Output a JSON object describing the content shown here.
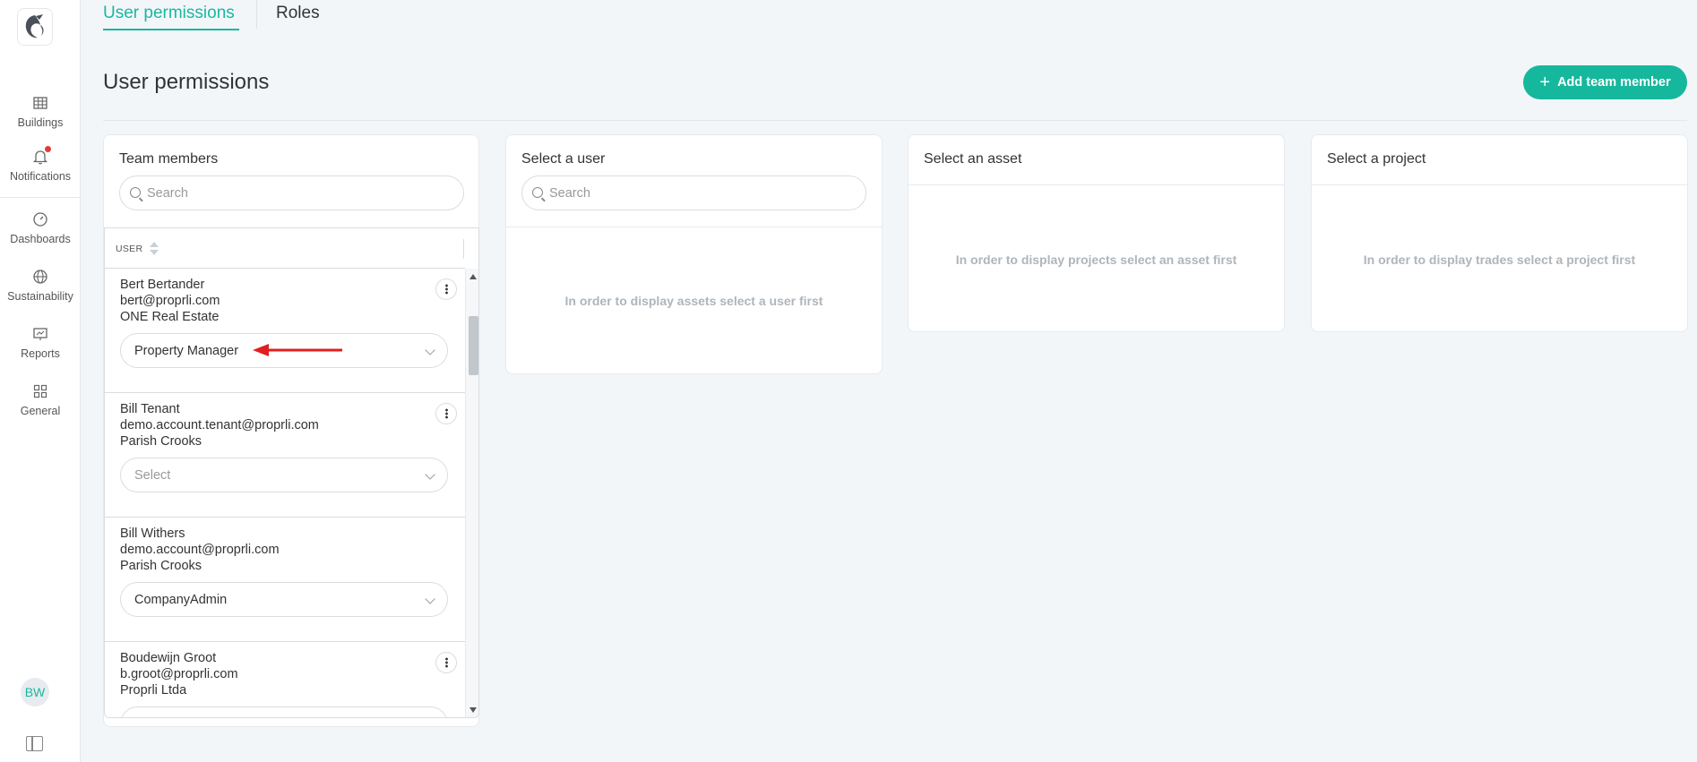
{
  "sidebar": {
    "items": [
      {
        "label": "Buildings",
        "icon": "buildings-icon"
      },
      {
        "label": "Notifications",
        "icon": "bell-icon"
      },
      {
        "label": "Dashboards",
        "icon": "gauge-icon"
      },
      {
        "label": "Sustainability",
        "icon": "globe-icon"
      },
      {
        "label": "Reports",
        "icon": "presentation-icon"
      },
      {
        "label": "General",
        "icon": "grid-icon"
      }
    ],
    "avatar_initials": "BW"
  },
  "tabs": [
    {
      "label": "User permissions",
      "active": true
    },
    {
      "label": "Roles",
      "active": false
    }
  ],
  "page": {
    "title": "User permissions",
    "add_button_label": "Add team member"
  },
  "team_members": {
    "title": "Team members",
    "search_placeholder": "Search",
    "column_header": "USER",
    "members": [
      {
        "name": "Bert Bertander",
        "email": "bert@proprli.com",
        "company": "ONE Real Estate",
        "role": "Property Manager"
      },
      {
        "name": "Bill Tenant",
        "email": "demo.account.tenant@proprli.com",
        "company": "Parish Crooks",
        "role": "Select"
      },
      {
        "name": "Bill Withers",
        "email": "demo.account@proprli.com",
        "company": "Parish Crooks",
        "role": "CompanyAdmin"
      },
      {
        "name": "Boudewijn Groot",
        "email": "b.groot@proprli.com",
        "company": "Proprli Ltda",
        "role": ""
      }
    ]
  },
  "select_user": {
    "title": "Select a user",
    "search_placeholder": "Search",
    "message": "In order to display assets select a user first"
  },
  "select_asset": {
    "title": "Select an asset",
    "message": "In order to display projects select an asset first"
  },
  "select_project": {
    "title": "Select a project",
    "message": "In order to display trades select a project first"
  },
  "colors": {
    "accent": "#15b89c",
    "annotation_arrow": "#e02020"
  }
}
